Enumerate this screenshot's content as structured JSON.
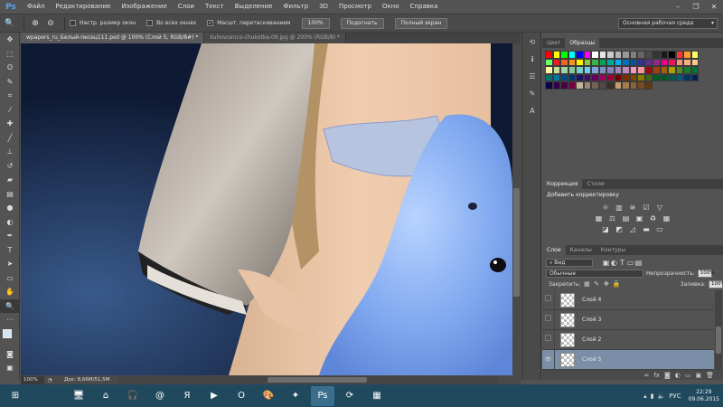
{
  "menu": {
    "logo": "Ps",
    "items": [
      "Файл",
      "Редактирование",
      "Изображение",
      "Слои",
      "Текст",
      "Выделение",
      "Фильтр",
      "3D",
      "Просмотр",
      "Окно",
      "Справка"
    ]
  },
  "options": {
    "resize_windows": "Настр. размер окон",
    "all_windows": "Во всех окнах",
    "scrubby_zoom": "Масшт. перетаскиванием",
    "scrubby_checked": "✓",
    "btn_100": "100%",
    "btn_fit": "Подогнать",
    "btn_fullscreen": "Полный экран",
    "workspace": "Основная рабочая среда"
  },
  "doc_tabs": [
    "wpapers_ru_Белый-песец111.psd @ 100% (Слой 5, RGB/8#) *",
    "kuhovcenco-chukotka-09.jpg @ 200% (RGB/8) *"
  ],
  "status": {
    "zoom": "100%",
    "doc_size": "Док: 8,66M/51,5M"
  },
  "swatches": {
    "tab_color": "Цвет",
    "tab_swatches": "Образцы",
    "colors": [
      "#ff0000",
      "#ffff00",
      "#00ff00",
      "#00ffff",
      "#0000ff",
      "#ff00ff",
      "#ffffff",
      "#e6e6e6",
      "#cccccc",
      "#b3b3b3",
      "#999999",
      "#808080",
      "#666666",
      "#4d4d4d",
      "#333333",
      "#1a1a1a",
      "#000000",
      "#ff3333",
      "#ff9933",
      "#ffff66",
      "#66ff66",
      "#ed1c24",
      "#f26522",
      "#f7941d",
      "#fff200",
      "#8dc63f",
      "#39b54a",
      "#00a651",
      "#00a99d",
      "#00aeef",
      "#0072bc",
      "#0054a6",
      "#2e3192",
      "#662d91",
      "#92278f",
      "#ec008c",
      "#ed145b",
      "#f69679",
      "#f9ad81",
      "#fdc68a",
      "#fff799",
      "#c4df9b",
      "#a3d39c",
      "#82ca9c",
      "#7accc8",
      "#6dcff6",
      "#7da7d9",
      "#8393ca",
      "#8781bd",
      "#a186be",
      "#bd8cbf",
      "#f49ac1",
      "#f5989d",
      "#9e0b0f",
      "#a0410d",
      "#a36209",
      "#aba000",
      "#598527",
      "#1a7b30",
      "#007236",
      "#00746b",
      "#0076a3",
      "#004b80",
      "#003471",
      "#1b1464",
      "#440e62",
      "#630460",
      "#9e005d",
      "#9e0039",
      "#790000",
      "#7b2e00",
      "#7d4900",
      "#827b00",
      "#406618",
      "#005e20",
      "#005826",
      "#005952",
      "#005b7f",
      "#003663",
      "#002157",
      "#0d004c",
      "#32004b",
      "#4b0049",
      "#7b0046",
      "#c7b299",
      "#998675",
      "#736357",
      "#534741",
      "#37302a",
      "#c69c6d",
      "#a67c52",
      "#8c6239",
      "#754c24",
      "#603913"
    ]
  },
  "adjustments": {
    "tab_adj": "Коррекция",
    "tab_styles": "Стили",
    "title": "Добавить корректировку",
    "row1": [
      "☼",
      "▥",
      "≋",
      "☑",
      "▽"
    ],
    "row2": [
      "▦",
      "⚖",
      "▤",
      "▣",
      "♻",
      "▦"
    ],
    "row3": [
      "◪",
      "◩",
      "◿",
      "▬",
      "▭"
    ]
  },
  "layers": {
    "tab_layers": "Слои",
    "tab_channels": "Каналы",
    "tab_paths": "Контуры",
    "filter": "Вид",
    "blend_mode": "Обычные",
    "opacity_label": "Непрозрачность:",
    "opacity": "100%",
    "lock_label": "Закрепить:",
    "fill_label": "Заливка:",
    "fill": "100%",
    "items": [
      {
        "name": "Слой 4",
        "selected": false,
        "visible": false
      },
      {
        "name": "Слой 3",
        "selected": false,
        "visible": false
      },
      {
        "name": "Слой 2",
        "selected": false,
        "visible": false
      },
      {
        "name": "Слой 5",
        "selected": true,
        "visible": true
      }
    ]
  },
  "taskbar": {
    "lang": "РУС",
    "time": "22:29",
    "date": "09.06.2015"
  }
}
